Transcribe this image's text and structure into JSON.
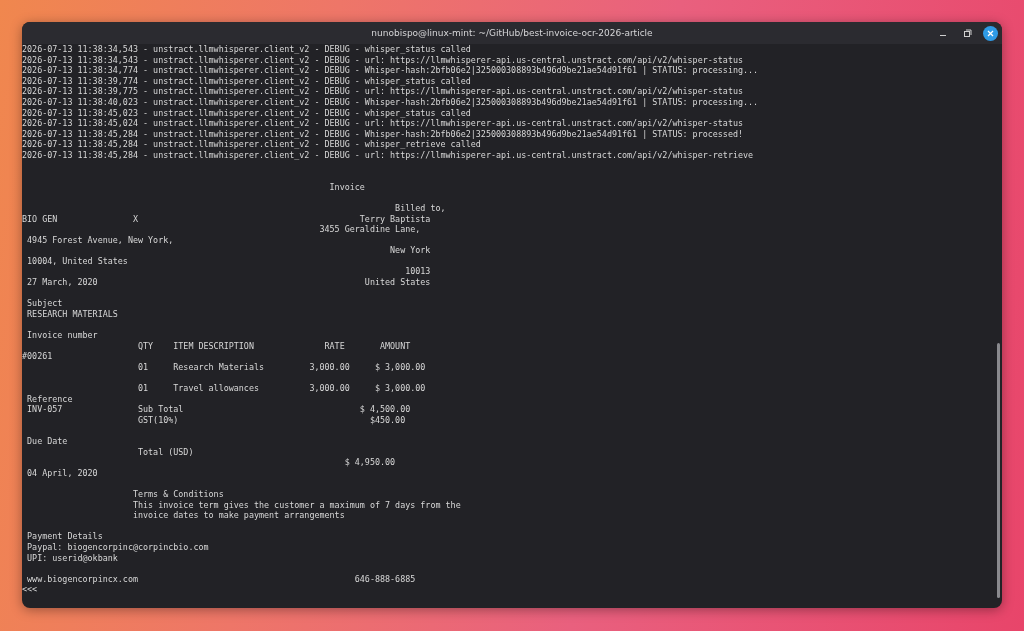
{
  "window": {
    "title": "nunobispo@linux-mint: ~/GitHub/best-invoice-ocr-2026-article"
  },
  "terminal_lines": [
    {
      "kind": "line",
      "text": "2026-07-13 11:38:34,543 - unstract.llmwhisperer.client_v2 - DEBUG - whisper_status called"
    },
    {
      "kind": "line",
      "text": "2026-07-13 11:38:34,543 - unstract.llmwhisperer.client_v2 - DEBUG - url: https://llmwhisperer-api.us-central.unstract.com/api/v2/whisper-status"
    },
    {
      "kind": "line",
      "text": "2026-07-13 11:38:34,774 - unstract.llmwhisperer.client_v2 - DEBUG - Whisper-hash:2bfb06e2|325000308893b496d9be21ae54d91f61 | STATUS: processing..."
    },
    {
      "kind": "line",
      "text": "2026-07-13 11:38:39,774 - unstract.llmwhisperer.client_v2 - DEBUG - whisper_status called"
    },
    {
      "kind": "line",
      "text": "2026-07-13 11:38:39,775 - unstract.llmwhisperer.client_v2 - DEBUG - url: https://llmwhisperer-api.us-central.unstract.com/api/v2/whisper-status"
    },
    {
      "kind": "line",
      "text": "2026-07-13 11:38:40,023 - unstract.llmwhisperer.client_v2 - DEBUG - Whisper-hash:2bfb06e2|325000308893b496d9be21ae54d91f61 | STATUS: processing..."
    },
    {
      "kind": "line",
      "text": "2026-07-13 11:38:45,023 - unstract.llmwhisperer.client_v2 - DEBUG - whisper_status called"
    },
    {
      "kind": "line",
      "text": "2026-07-13 11:38:45,024 - unstract.llmwhisperer.client_v2 - DEBUG - url: https://llmwhisperer-api.us-central.unstract.com/api/v2/whisper-status"
    },
    {
      "kind": "line",
      "text": "2026-07-13 11:38:45,284 - unstract.llmwhisperer.client_v2 - DEBUG - Whisper-hash:2bfb06e2|325000308893b496d9be21ae54d91f61 | STATUS: processed!"
    },
    {
      "kind": "line",
      "text": "2026-07-13 11:38:45,284 - unstract.llmwhisperer.client_v2 - DEBUG - whisper_retrieve called"
    },
    {
      "kind": "line",
      "text": "2026-07-13 11:38:45,284 - unstract.llmwhisperer.client_v2 - DEBUG - url: https://llmwhisperer-api.us-central.unstract.com/api/v2/whisper-retrieve"
    },
    {
      "kind": "blank"
    },
    {
      "kind": "blank"
    },
    {
      "kind": "line",
      "text": "                                                             Invoice"
    },
    {
      "kind": "blank"
    },
    {
      "kind": "line",
      "text": "                                                                          Billed to,"
    },
    {
      "kind": "line",
      "text": "BIO GEN               X                                            Terry Baptista"
    },
    {
      "kind": "line",
      "text": "                                                           3455 Geraldine Lane,"
    },
    {
      "kind": "line",
      "text": " 4945 Forest Avenue, New York,"
    },
    {
      "kind": "line",
      "text": "                                                                         New York"
    },
    {
      "kind": "line",
      "text": " 10004, United States"
    },
    {
      "kind": "line",
      "text": "                                                                            10013"
    },
    {
      "kind": "line",
      "text": " 27 March, 2020                                                     United States"
    },
    {
      "kind": "blank"
    },
    {
      "kind": "line",
      "text": " Subject"
    },
    {
      "kind": "line",
      "text": " RESEARCH MATERIALS"
    },
    {
      "kind": "blank"
    },
    {
      "kind": "line",
      "text": " Invoice number"
    },
    {
      "kind": "line",
      "text": "                       QTY    ITEM DESCRIPTION              RATE       AMOUNT"
    },
    {
      "kind": "line",
      "text": "#00261"
    },
    {
      "kind": "line",
      "text": "                       01     Research Materials         3,000.00     $ 3,000.00"
    },
    {
      "kind": "blank"
    },
    {
      "kind": "line",
      "text": "                       01     Travel allowances          3,000.00     $ 3,000.00"
    },
    {
      "kind": "line",
      "text": " Reference"
    },
    {
      "kind": "line",
      "text": " INV-057               Sub Total                                   $ 4,500.00"
    },
    {
      "kind": "line",
      "text": "                       GST(10%)                                      $450.00"
    },
    {
      "kind": "blank"
    },
    {
      "kind": "line",
      "text": " Due Date"
    },
    {
      "kind": "line",
      "text": "                       Total (USD)"
    },
    {
      "kind": "line",
      "text": "                                                                $ 4,950.00"
    },
    {
      "kind": "line",
      "text": " 04 April, 2020"
    },
    {
      "kind": "blank"
    },
    {
      "kind": "line",
      "text": "                      Terms & Conditions"
    },
    {
      "kind": "line",
      "text": "                      This invoice term gives the customer a maximum of 7 days from the"
    },
    {
      "kind": "line",
      "text": "                      invoice dates to make payment arrangements"
    },
    {
      "kind": "blank"
    },
    {
      "kind": "line",
      "text": " Payment Details"
    },
    {
      "kind": "line",
      "text": " Paypal: biogencorpinc@corpincbio.com"
    },
    {
      "kind": "line",
      "text": " UPI: userid@okbank"
    },
    {
      "kind": "blank"
    },
    {
      "kind": "line",
      "text": " www.biogencorpincx.com                                           646-888-6885"
    },
    {
      "kind": "line",
      "text": "<<<"
    }
  ]
}
